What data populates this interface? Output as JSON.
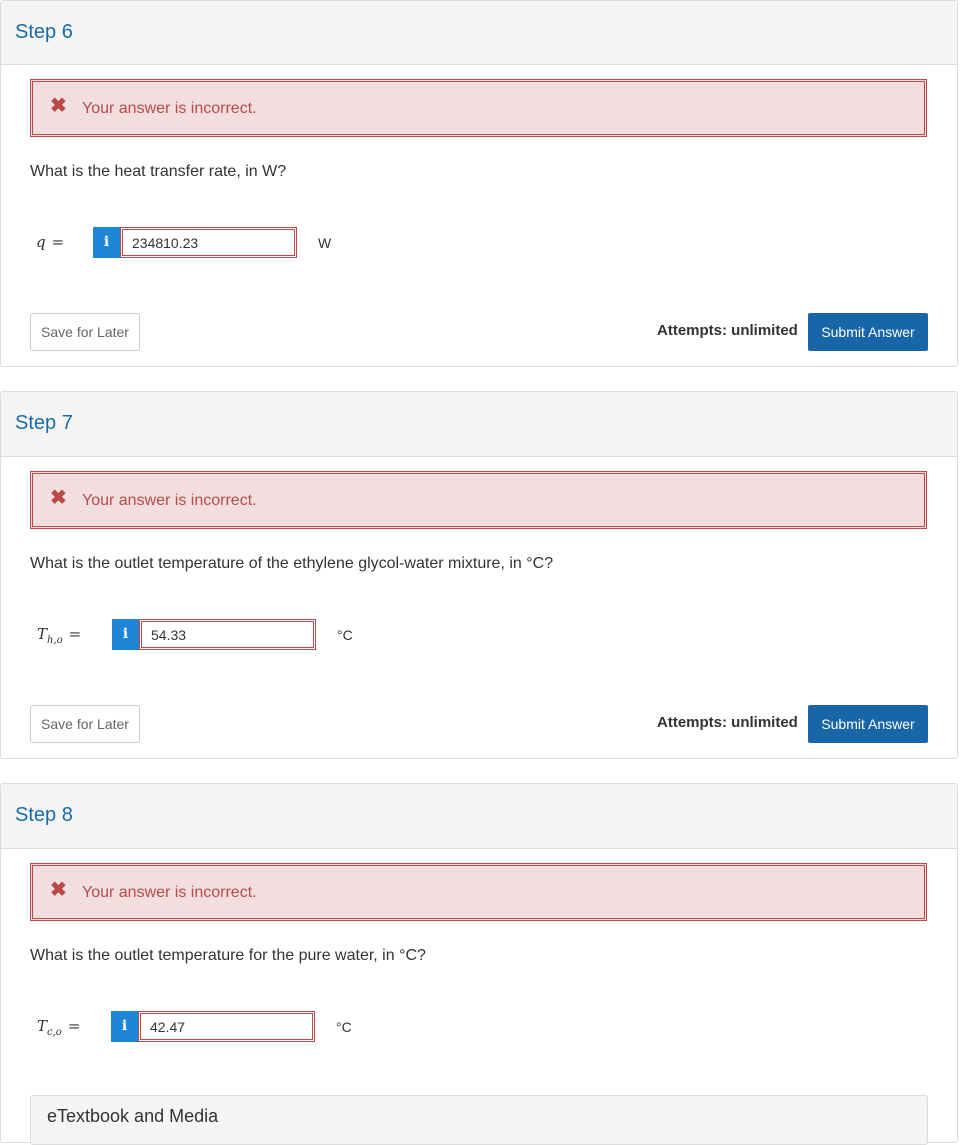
{
  "alert_icon": "x-icon",
  "info_icon": "info-icon",
  "colors": {
    "step_title": "#1a6aa6",
    "alert_bg": "#f2dede",
    "alert_text": "#b94a48",
    "submit_bg": "#1866a8",
    "info_bg": "#1d87d6"
  },
  "steps": [
    {
      "title": "Step 6",
      "alert": "Your answer is incorrect.",
      "question": "What is the heat transfer rate, in W?",
      "variable": {
        "symbol": "q",
        "subscript": "",
        "equals": "="
      },
      "info_label": "i",
      "answer_value": "234810.23",
      "unit": "W",
      "save_label": "Save for Later",
      "attempts": "Attempts: unlimited",
      "submit_label": "Submit Answer"
    },
    {
      "title": "Step 7",
      "alert": "Your answer is incorrect.",
      "question": "What is the outlet temperature of the ethylene glycol-water mixture, in °C?",
      "variable": {
        "symbol": "T",
        "subscript": "h,o",
        "equals": "="
      },
      "info_label": "i",
      "answer_value": "54.33",
      "unit": "°C",
      "save_label": "Save for Later",
      "attempts": "Attempts: unlimited",
      "submit_label": "Submit Answer"
    },
    {
      "title": "Step 8",
      "alert": "Your answer is incorrect.",
      "question": "What is the outlet temperature for the pure water, in °C?",
      "variable": {
        "symbol": "T",
        "subscript": "c,o",
        "equals": "="
      },
      "info_label": "i",
      "answer_value": "42.47",
      "unit": "°C"
    }
  ],
  "etextbook_label": "eTextbook and Media"
}
